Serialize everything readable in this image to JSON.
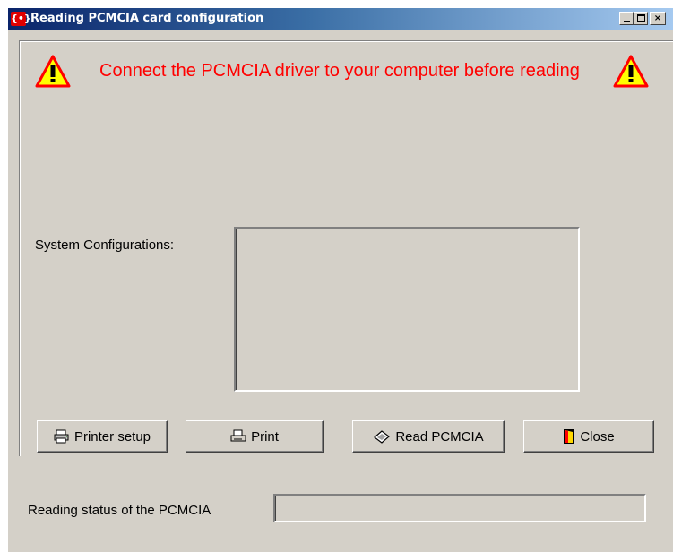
{
  "window": {
    "title": "Reading PCMCIA card configuration",
    "app_icon": "red-app-icon",
    "controls": {
      "minimize": "minimize-icon",
      "maximize": "maximize-icon",
      "close": "close-icon",
      "close_glyph": "×"
    }
  },
  "warning": {
    "icon": "warning-triangle-icon",
    "message": "Connect the PCMCIA driver to your computer before reading",
    "color": "#ff0000"
  },
  "system": {
    "label": "System Configurations:",
    "value": ""
  },
  "buttons": {
    "printer_setup": {
      "label": "Printer setup",
      "icon": "printer-setup-icon"
    },
    "print": {
      "label": "Print",
      "icon": "printer-icon"
    },
    "read": {
      "label": "Read PCMCIA",
      "icon": "card-icon"
    },
    "close": {
      "label": "Close",
      "icon": "door-icon"
    }
  },
  "status": {
    "label": "Reading status of the PCMCIA",
    "value": ""
  }
}
